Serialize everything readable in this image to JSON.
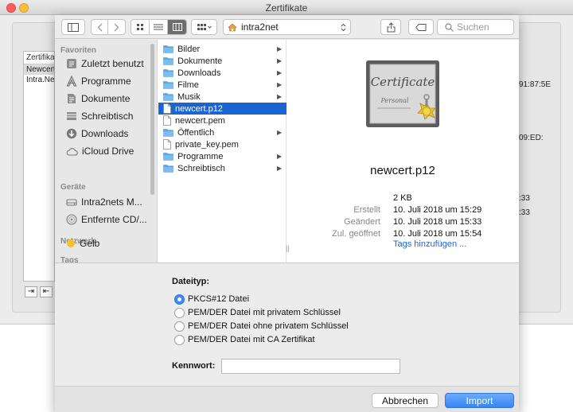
{
  "window": {
    "title": "Zertifikate"
  },
  "background": {
    "list_header": "Zertifikate",
    "rows": [
      "Newcert",
      "Intra.Net"
    ],
    "peek": [
      "91:87:5E",
      "09:ED:",
      ":33",
      ":33"
    ]
  },
  "toolbar": {
    "location": "intra2net",
    "search_placeholder": "Suchen"
  },
  "sidebar": {
    "sections": {
      "favorites": "Favoriten",
      "devices": "Geräte",
      "network": "Netzwerk",
      "tags": "Tags"
    },
    "favorites": [
      "Zuletzt benutzt",
      "Programme",
      "Dokumente",
      "Schreibtisch",
      "Downloads",
      "iCloud Drive"
    ],
    "devices": [
      "Intra2nets M...",
      "Entfernte CD/..."
    ],
    "tags": [
      "Gelb"
    ],
    "tag_color": "#f6c22b"
  },
  "files": [
    {
      "name": "Bilder",
      "kind": "folder"
    },
    {
      "name": "Dokumente",
      "kind": "folder"
    },
    {
      "name": "Downloads",
      "kind": "folder"
    },
    {
      "name": "Filme",
      "kind": "folder"
    },
    {
      "name": "Musik",
      "kind": "folder"
    },
    {
      "name": "newcert.p12",
      "kind": "file",
      "selected": true
    },
    {
      "name": "newcert.pem",
      "kind": "file"
    },
    {
      "name": "Öffentlich",
      "kind": "folder"
    },
    {
      "name": "private_key.pem",
      "kind": "file"
    },
    {
      "name": "Programme",
      "kind": "folder"
    },
    {
      "name": "Schreibtisch",
      "kind": "folder"
    }
  ],
  "preview": {
    "icon_text_1": "Certificate",
    "icon_text_2": "Personal",
    "filename": "newcert.p12",
    "size": "2 KB",
    "created_label": "Erstellt",
    "created": "10. Juli 2018 um 15:29",
    "modified_label": "Geändert",
    "modified": "10. Juli 2018 um 15:33",
    "opened_label": "Zul. geöffnet",
    "opened": "10. Juli 2018 um 15:54",
    "tags_link": "Tags hinzufügen ..."
  },
  "options": {
    "type_label": "Dateityp:",
    "types": [
      {
        "label": "PKCS#12 Datei",
        "selected": true
      },
      {
        "label": "PEM/DER Datei mit privatem Schlüssel",
        "selected": false
      },
      {
        "label": "PEM/DER Datei ohne privatem Schlüssel",
        "selected": false
      },
      {
        "label": "PEM/DER Datei mit CA Zertifikat",
        "selected": false
      }
    ],
    "password_label": "Kennwort:",
    "password_value": ""
  },
  "buttons": {
    "cancel": "Abbrechen",
    "import": "Import"
  },
  "colors": {
    "accent": "#1b65d3",
    "folder": "#5aa9e8",
    "primary_button": "#3685f5",
    "link": "#1f64d2"
  }
}
